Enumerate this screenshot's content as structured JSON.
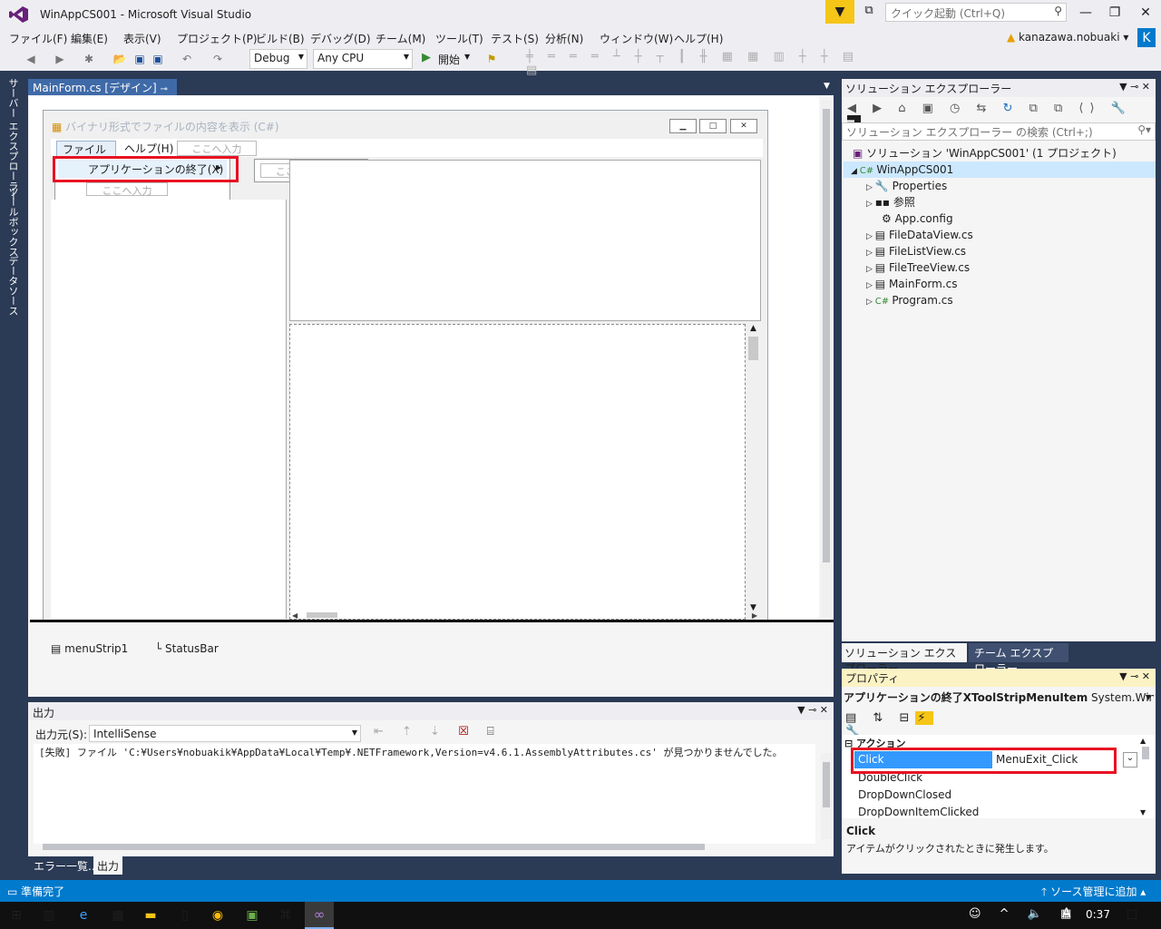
{
  "window": {
    "title": "WinAppCS001 - Microsoft Visual Studio",
    "quick_launch_placeholder": "クイック起動 (Ctrl+Q)",
    "user": "kanazawa.nobuaki",
    "user_initial": "K"
  },
  "menu": [
    "ファイル(F)",
    "編集(E)",
    "表示(V)",
    "プロジェクト(P)",
    "ビルド(B)",
    "デバッグ(D)",
    "チーム(M)",
    "ツール(T)",
    "テスト(S)",
    "分析(N)",
    "ウィンドウ(W)",
    "ヘルプ(H)"
  ],
  "toolbar": {
    "config": "Debug",
    "platform": "Any CPU",
    "start": "開始"
  },
  "left_tabs": [
    "サーバー エクスプローラー",
    "ツールボックス",
    "データソース"
  ],
  "designer": {
    "tab_label": "MainForm.cs [デザイン]",
    "form_title": "バイナリ形式でファイルの内容を表示 (C#)",
    "form_menu": [
      "ファイル(F)",
      "ヘルプ(H)"
    ],
    "type_here": "ここへ入力",
    "dropdown_item": "アプリケーションの終了(X)",
    "tray_items": [
      "menuStrip1",
      "StatusBar"
    ]
  },
  "output": {
    "title": "出力",
    "source_label": "出力元(S):",
    "source_value": "IntelliSense",
    "text": "[失敗] ファイル 'C:¥Users¥nobuakik¥AppData¥Local¥Temp¥.NETFramework,Version=v4.6.1.AssemblyAttributes.cs' が見つかりませんでした。",
    "tabs": [
      "エラー一覧...",
      "出力"
    ]
  },
  "solution_explorer": {
    "title": "ソリューション エクスプローラー",
    "search_placeholder": "ソリューション エクスプローラー の検索 (Ctrl+;)",
    "solution": "ソリューション 'WinAppCS001' (1 プロジェクト)",
    "project": "WinAppCS001",
    "items": [
      "Properties",
      "参照",
      "App.config",
      "FileDataView.cs",
      "FileListView.cs",
      "FileTreeView.cs",
      "MainForm.cs",
      "Program.cs"
    ],
    "tabs": [
      "ソリューション エクスプローラー",
      "チーム エクスプローラー"
    ]
  },
  "properties": {
    "title": "プロパティ",
    "object_name": "アプリケーションの終了XToolStripMenuItem",
    "object_type": "System.Windows.Fo",
    "category": "アクション",
    "rows": [
      {
        "name": "Click",
        "value": "MenuExit_Click"
      },
      {
        "name": "DoubleClick",
        "value": ""
      },
      {
        "name": "DropDownClosed",
        "value": ""
      },
      {
        "name": "DropDownItemClicked",
        "value": ""
      }
    ],
    "desc_title": "Click",
    "desc_text": "アイテムがクリックされたときに発生します。"
  },
  "status": {
    "left": "準備完了",
    "right": "ソース管理に追加"
  },
  "taskbar": {
    "time": "0:37",
    "ime": "A"
  }
}
